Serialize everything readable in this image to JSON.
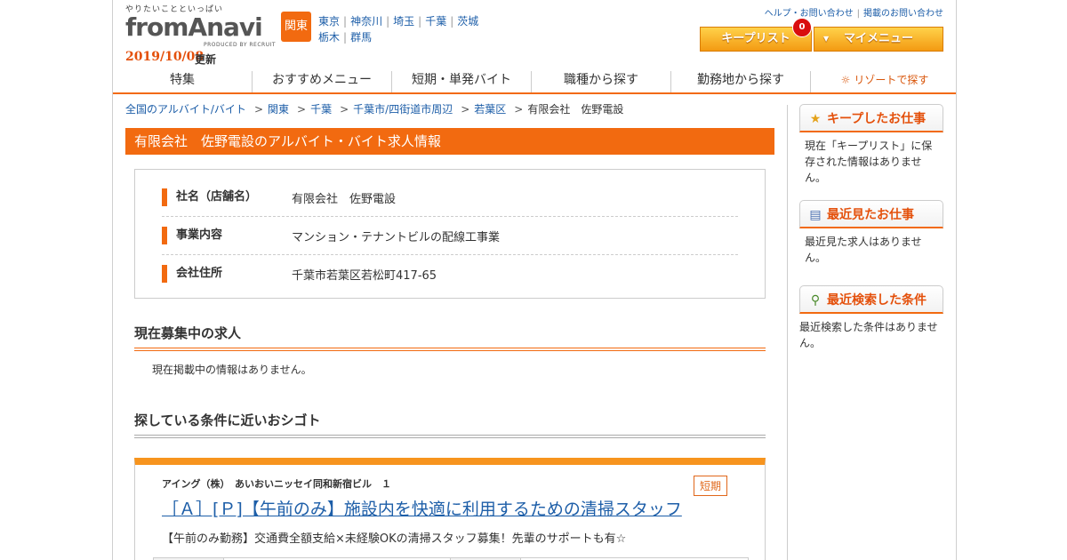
{
  "header": {
    "tagline": "やりたいことといっぱい",
    "logo_text_pre": "from",
    "logo_text_a": "A",
    "logo_text_post": "navi",
    "produced_by": "PRODUCED BY RECRUIT",
    "update_date": "2019/10/08",
    "update_suffix": "更新",
    "region_badge": "関東",
    "regions_row1": [
      "東京",
      "神奈川",
      "埼玉",
      "千葉",
      "茨城"
    ],
    "regions_row2": [
      "栃木",
      "群馬"
    ],
    "help_link": "ヘルプ・お問い合わせ",
    "contact_link": "掲載のお問い合わせ",
    "keep_list_label": "キープリスト",
    "keep_count": "0",
    "my_menu_label": "マイメニュー"
  },
  "nav": {
    "items": [
      "特集",
      "おすすめメニュー",
      "短期・単発バイト",
      "職種から探す",
      "勤務地から探す"
    ],
    "resort_label": "リゾートで探す"
  },
  "breadcrumb": [
    "全国のアルバイト/バイト",
    "関東",
    "千葉",
    "千葉市/四街道市周辺",
    "若葉区"
  ],
  "breadcrumb_current": "有限会社　佐野電設",
  "page_title": "有限会社　佐野電設のアルバイト・バイト求人情報",
  "company": {
    "rows": [
      {
        "label": "社名（店舗名）",
        "value": "有限会社　佐野電設"
      },
      {
        "label": "事業内容",
        "value": "マンション・テナントビルの配線工事業"
      },
      {
        "label": "会社住所",
        "value": "千葉市若葉区若松町417-65"
      }
    ]
  },
  "current_jobs": {
    "heading": "現在募集中の求人",
    "empty_text": "現在掲載中の情報はありません。"
  },
  "similar": {
    "heading": "探している条件に近いおシゴト",
    "job": {
      "company": "アイング（株）　あいおいニッセイ同和新宿ビル　１",
      "tag": "短期",
      "title": "［Ａ］[Ｐ]【午前のみ】施設内を快適に利用するための清掃スタッフ",
      "description": "【午前のみ勤務】交通費全額支給×未経験OKの清掃スタッフ募集！先輩のサポートも有☆"
    }
  },
  "sidebar": {
    "keep": {
      "heading": "キープしたお仕事",
      "icon": "star-icon",
      "body": "現在「キープリスト」に保存された情報はありません。"
    },
    "recent": {
      "heading": "最近見たお仕事",
      "icon": "document-icon",
      "body": "最近見た求人はありません。"
    },
    "search": {
      "heading": "最近検索した条件",
      "icon": "magnifier-icon",
      "body": "最近検索した条件はありません。"
    }
  },
  "colors": {
    "accent": "#f26a10",
    "link": "#1d5ea8",
    "keep_button": "#f39a12"
  }
}
